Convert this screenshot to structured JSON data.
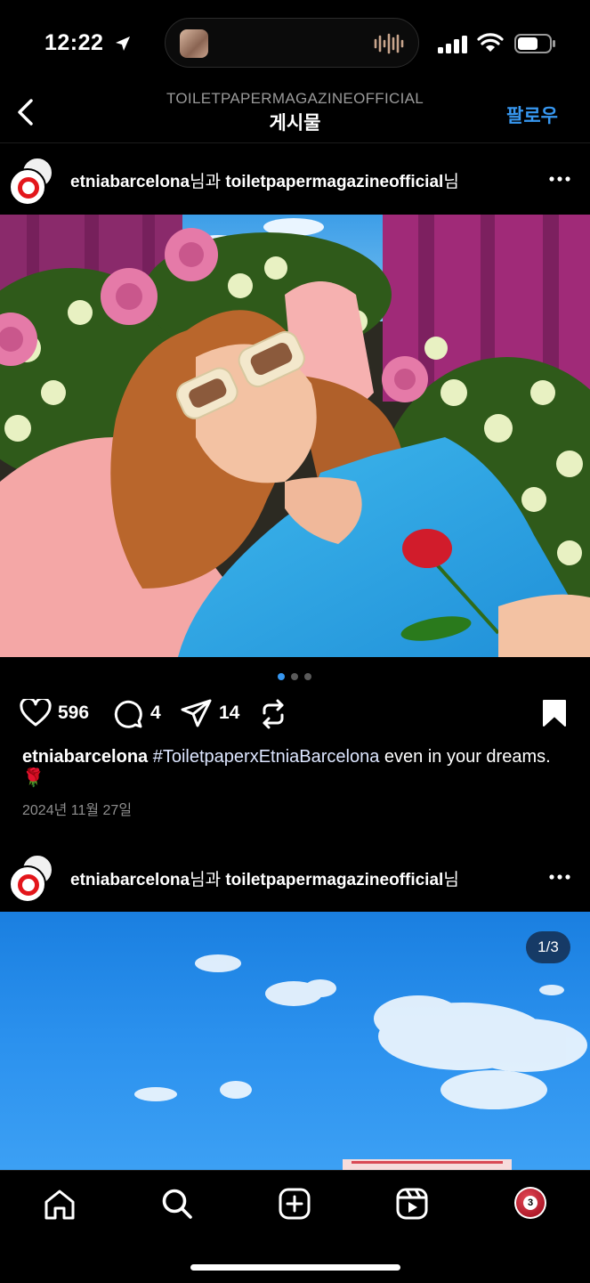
{
  "status_bar": {
    "time": "12:22"
  },
  "header": {
    "account": "TOILETPAPERMAGAZINEOFFICIAL",
    "title": "게시물",
    "follow_label": "팔로우"
  },
  "posts": [
    {
      "user1": "etniabarcelona",
      "joiner": "님과 ",
      "user2": "toiletpapermagazineofficial",
      "suffix": "님",
      "likes": "596",
      "comments": "4",
      "shares": "14",
      "caption_user": "etniabarcelona",
      "caption_tag": "#ToiletpaperxEtniaBarcelona",
      "caption_text": " even in your dreams.🌹",
      "date": "2024년 11월 27일",
      "carousel_index": 1,
      "carousel_total": 3
    },
    {
      "user1": "etniabarcelona",
      "joiner": "님과 ",
      "user2": "toiletpapermagazineofficial",
      "suffix": "님",
      "counter": "1/3"
    }
  ],
  "tab_bar": {
    "items": [
      "home-icon",
      "search-icon",
      "create-icon",
      "reels-icon",
      "profile-avatar"
    ],
    "profile_badge": "3"
  },
  "colors": {
    "accent": "#3797f0",
    "background": "#000000",
    "active_dot": "#3797f0"
  }
}
